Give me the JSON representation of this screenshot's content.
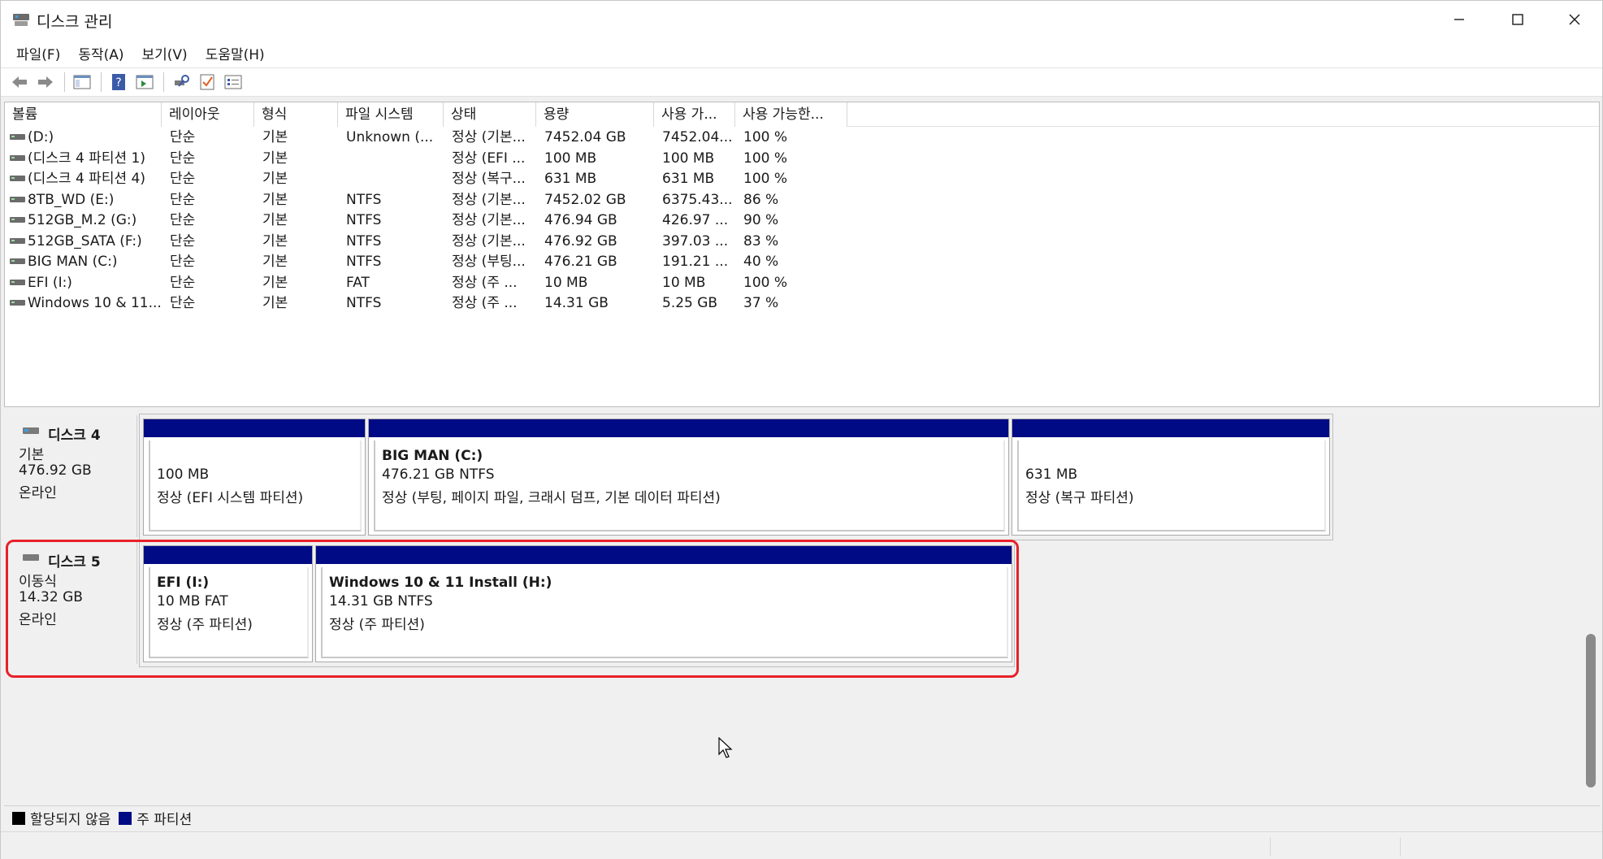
{
  "window": {
    "title": "디스크 관리",
    "minimize_icon": "minimize-icon",
    "maximize_icon": "maximize-icon",
    "close_icon": "close-icon"
  },
  "menu": [
    "파일(F)",
    "동작(A)",
    "보기(V)",
    "도움말(H)"
  ],
  "toolbar": {
    "icons": [
      "back-arrow-icon",
      "forward-arrow-icon",
      "console-tree-icon",
      "help-icon",
      "action-pane-icon",
      "rescan-icon",
      "checklist-icon",
      "properties-icon"
    ]
  },
  "volume_list": {
    "columns": [
      "볼륨",
      "레이아웃",
      "형식",
      "파일 시스템",
      "상태",
      "용량",
      "사용 가...",
      "사용 가능한..."
    ],
    "rows": [
      {
        "volume": " (D:)",
        "layout": "단순",
        "type": "기본",
        "fs": "Unknown (...",
        "status": "정상 (기본...",
        "capacity": "7452.04 GB",
        "free": "7452.04...",
        "pct": "100 %"
      },
      {
        "volume": "(디스크 4 파티션 1)",
        "layout": "단순",
        "type": "기본",
        "fs": "",
        "status": "정상 (EFI ...",
        "capacity": "100 MB",
        "free": "100 MB",
        "pct": "100 %"
      },
      {
        "volume": "(디스크 4 파티션 4)",
        "layout": "단순",
        "type": "기본",
        "fs": "",
        "status": "정상 (복구...",
        "capacity": "631 MB",
        "free": "631 MB",
        "pct": "100 %"
      },
      {
        "volume": "8TB_WD (E:)",
        "layout": "단순",
        "type": "기본",
        "fs": "NTFS",
        "status": "정상 (기본...",
        "capacity": "7452.02 GB",
        "free": "6375.43...",
        "pct": "86 %"
      },
      {
        "volume": "512GB_M.2 (G:)",
        "layout": "단순",
        "type": "기본",
        "fs": "NTFS",
        "status": "정상 (기본...",
        "capacity": "476.94 GB",
        "free": "426.97 ...",
        "pct": "90 %"
      },
      {
        "volume": "512GB_SATA (F:)",
        "layout": "단순",
        "type": "기본",
        "fs": "NTFS",
        "status": "정상 (기본...",
        "capacity": "476.92 GB",
        "free": "397.03 ...",
        "pct": "83 %"
      },
      {
        "volume": "BIG MAN (C:)",
        "layout": "단순",
        "type": "기본",
        "fs": "NTFS",
        "status": "정상 (부팅...",
        "capacity": "476.21 GB",
        "free": "191.21 ...",
        "pct": "40 %"
      },
      {
        "volume": "EFI (I:)",
        "layout": "단순",
        "type": "기본",
        "fs": "FAT",
        "status": "정상 (주 ...",
        "capacity": "10 MB",
        "free": "10 MB",
        "pct": "100 %"
      },
      {
        "volume": "Windows 10 & 11...",
        "layout": "단순",
        "type": "기본",
        "fs": "NTFS",
        "status": "정상 (주 ...",
        "capacity": "14.31 GB",
        "free": "5.25 GB",
        "pct": "37 %"
      }
    ]
  },
  "disks": [
    {
      "name": "디스크 4",
      "kind": "기본",
      "size": "476.92 GB",
      "state": "온라인",
      "partitions": [
        {
          "title": "",
          "size": "100 MB",
          "status": "정상 (EFI 시스템 파티션)"
        },
        {
          "title": "BIG MAN  (C:)",
          "size": "476.21 GB NTFS",
          "status": "정상 (부팅, 페이지 파일, 크래시 덤프, 기본 데이터 파티션)"
        },
        {
          "title": "",
          "size": "631 MB",
          "status": "정상 (복구 파티션)"
        }
      ]
    },
    {
      "name": "디스크 5",
      "kind": "이동식",
      "size": "14.32 GB",
      "state": "온라인",
      "highlighted": true,
      "partitions": [
        {
          "title": "EFI  (I:)",
          "size": "10 MB FAT",
          "status": "정상 (주 파티션)"
        },
        {
          "title": "Windows 10 & 11 Install  (H:)",
          "size": "14.31 GB NTFS",
          "status": "정상 (주 파티션)"
        }
      ]
    }
  ],
  "legend": [
    {
      "label": "할당되지 않음",
      "color": "#000000"
    },
    {
      "label": "주 파티션",
      "color": "#000a84"
    }
  ],
  "colors": {
    "partition_bar": "#000a84",
    "highlight": "#e8202a"
  }
}
